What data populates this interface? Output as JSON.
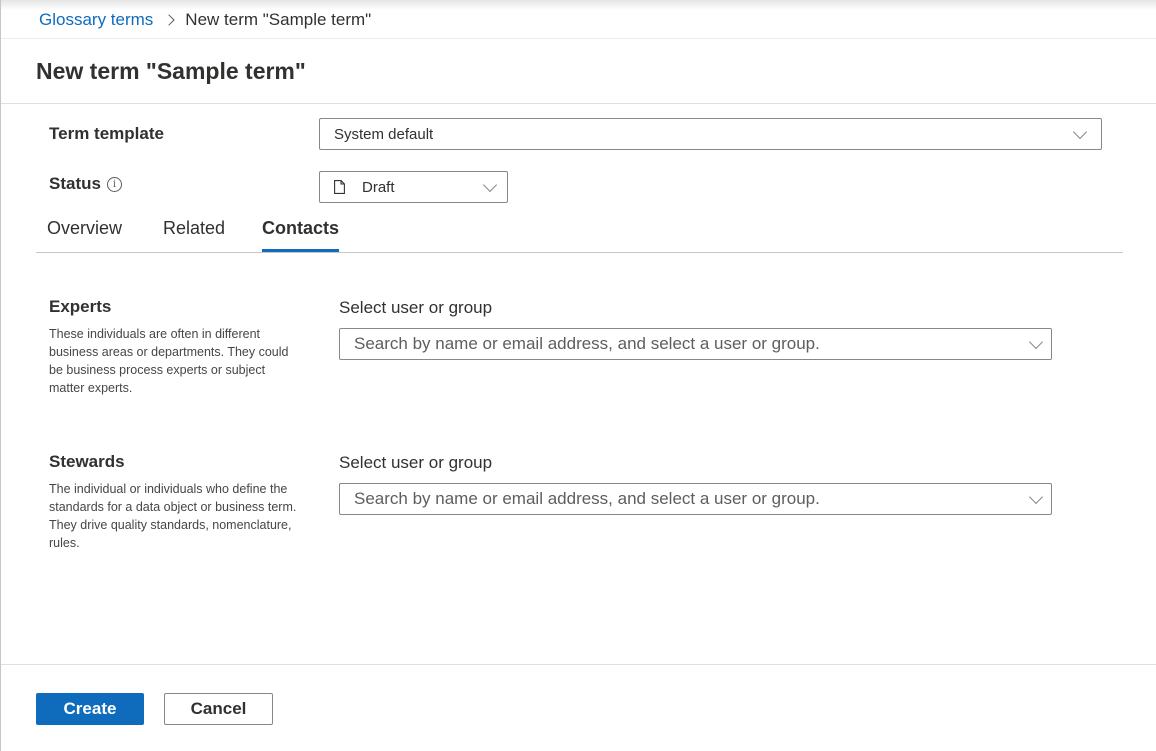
{
  "breadcrumb": {
    "parent": "Glossary terms",
    "current": "New term \"Sample term\""
  },
  "page": {
    "title": "New term \"Sample term\""
  },
  "fields": {
    "term_template": {
      "label": "Term template",
      "value": "System default"
    },
    "status": {
      "label": "Status",
      "info_icon": "info-icon",
      "value": "Draft",
      "value_icon": "document-icon"
    }
  },
  "tabs": [
    {
      "label": "Overview",
      "active": false
    },
    {
      "label": "Related",
      "active": false
    },
    {
      "label": "Contacts",
      "active": true
    }
  ],
  "contacts": {
    "experts": {
      "title": "Experts",
      "description": "These individuals are often in different business areas or departments. They could be business process experts or subject matter experts.",
      "select_label": "Select user or group",
      "placeholder": "Search by name or email address, and select a user or group."
    },
    "stewards": {
      "title": "Stewards",
      "description": "The individual or individuals who define the standards for a data object or business term. They drive quality standards, nomenclature, rules.",
      "select_label": "Select user or group",
      "placeholder": "Search by name or email address, and select a user or group."
    }
  },
  "footer": {
    "create_label": "Create",
    "cancel_label": "Cancel"
  },
  "colors": {
    "accent": "#0f6cbd",
    "text": "#323130",
    "border": "#8a8886"
  }
}
